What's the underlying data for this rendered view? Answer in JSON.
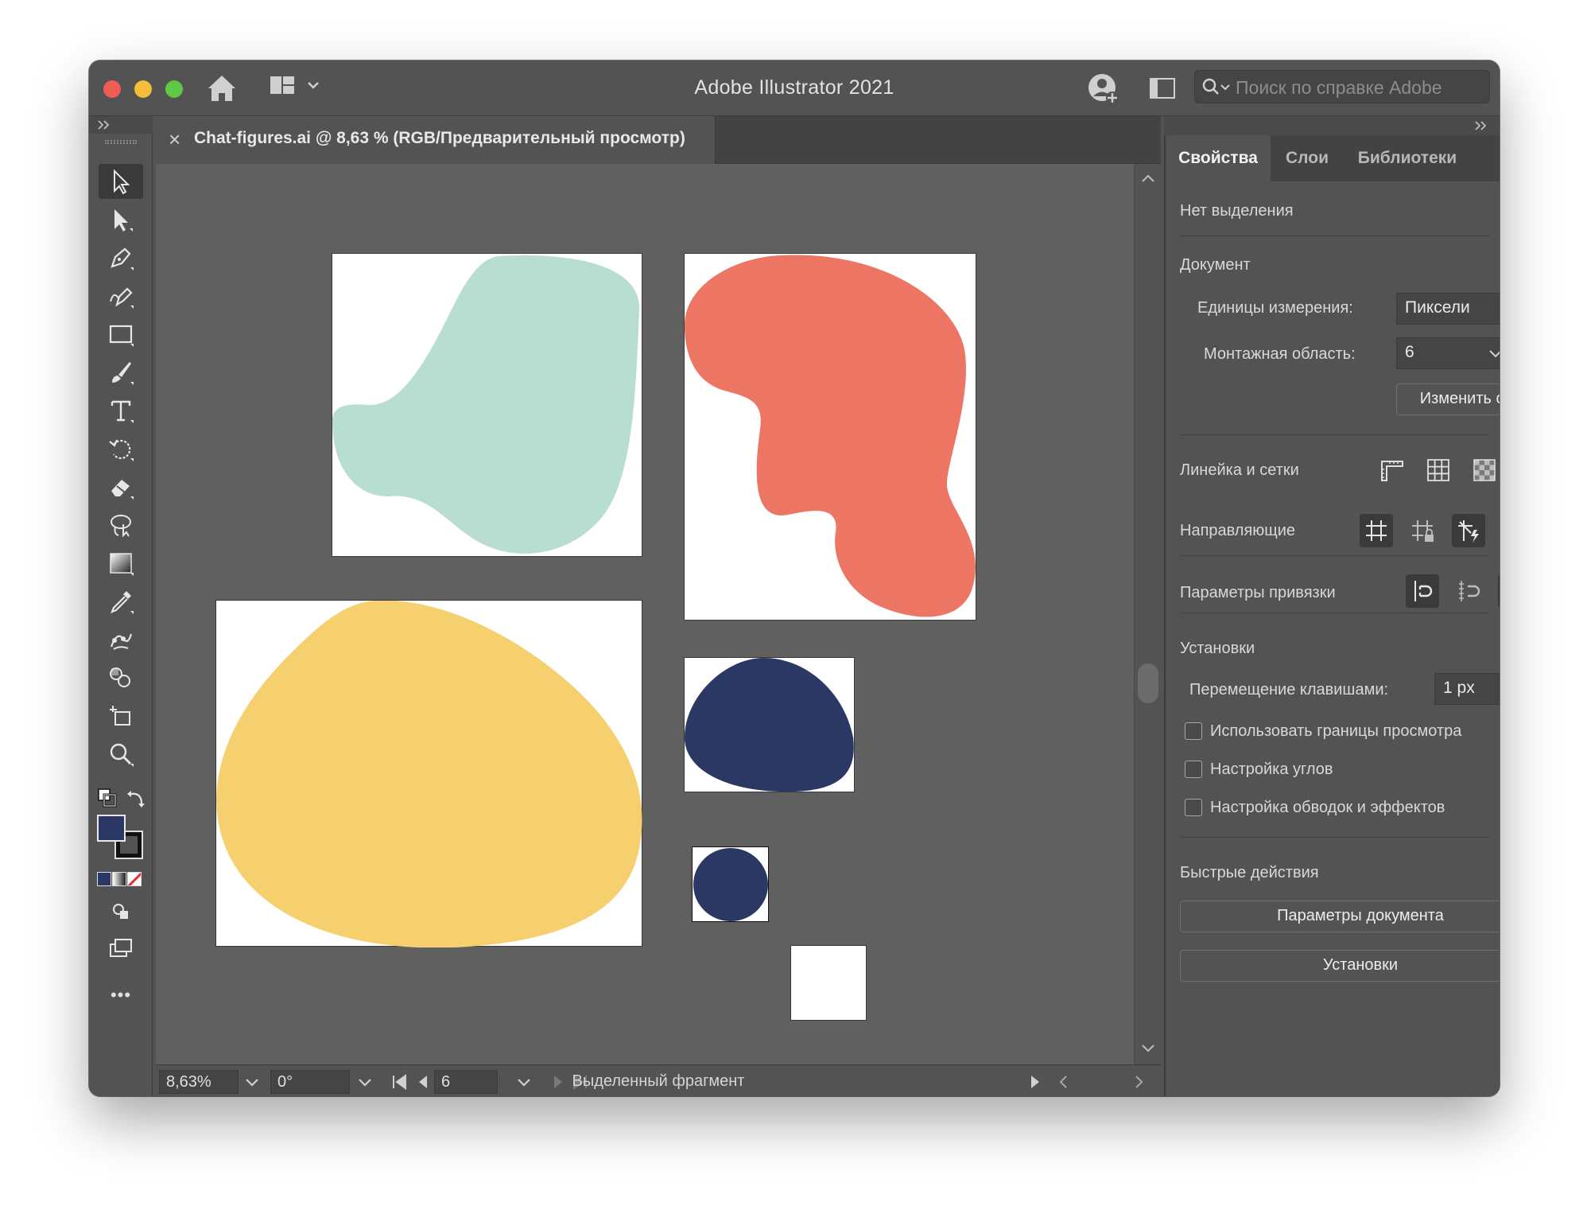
{
  "app": {
    "title": "Adobe Illustrator 2021"
  },
  "search": {
    "placeholder": "Поиск по справке Adobe"
  },
  "document": {
    "tab_title": "Chat-figures.ai @ 8,63 % (RGB/Предварительный просмотр)",
    "close_glyph": "×"
  },
  "toolbar": {
    "tools": [
      "selection-tool",
      "direct-selection-tool",
      "pen-tool",
      "curvature-tool",
      "rectangle-tool",
      "paintbrush-tool",
      "type-tool",
      "rotate-tool",
      "eraser-tool",
      "lasso-tool",
      "gradient-tool",
      "eyedropper-tool",
      "puppet-warp-tool",
      "shape-builder-tool",
      "artboard-tool",
      "zoom-tool"
    ],
    "fill_color": "#2b3864",
    "more_glyph": "•••"
  },
  "artboards": [
    {
      "name": "artboard-mint",
      "shape_color": "#b8ded1"
    },
    {
      "name": "artboard-coral",
      "shape_color": "#ec7563"
    },
    {
      "name": "artboard-yellow",
      "shape_color": "#f6cf6f"
    },
    {
      "name": "artboard-navy-blob",
      "shape_color": "#2b3864"
    },
    {
      "name": "artboard-navy-circle",
      "shape_color": "#2b3864"
    },
    {
      "name": "artboard-empty",
      "shape_color": ""
    }
  ],
  "statusbar": {
    "zoom": "8,63%",
    "rotation": "0°",
    "artboard": "6",
    "info": "Выделенный фрагмент"
  },
  "panel": {
    "tabs": [
      "Свойства",
      "Слои",
      "Библиотеки"
    ],
    "active_tab": "Свойства",
    "no_selection": "Нет выделения",
    "document_section": "Документ",
    "units_label": "Единицы измерения:",
    "units_value": "Пиксели",
    "artboard_label": "Монтажная область:",
    "artboard_value": "6",
    "edit_artboards": "Изменить области",
    "rulers_grids": "Линейка и сетки",
    "guides": "Направляющие",
    "snap_options": "Параметры привязки",
    "preferences_section": "Установки",
    "keyboard_increment_label": "Перемещение клавишами:",
    "keyboard_increment_value": "1 px",
    "checkboxes": [
      {
        "label": "Использовать границы просмотра",
        "checked": false
      },
      {
        "label": "Настройка углов",
        "checked": false
      },
      {
        "label": "Настройка обводок и эффектов",
        "checked": false
      }
    ],
    "quick_actions": "Быстрые действия",
    "doc_setup_button": "Параметры документа",
    "preferences_button": "Установки"
  }
}
